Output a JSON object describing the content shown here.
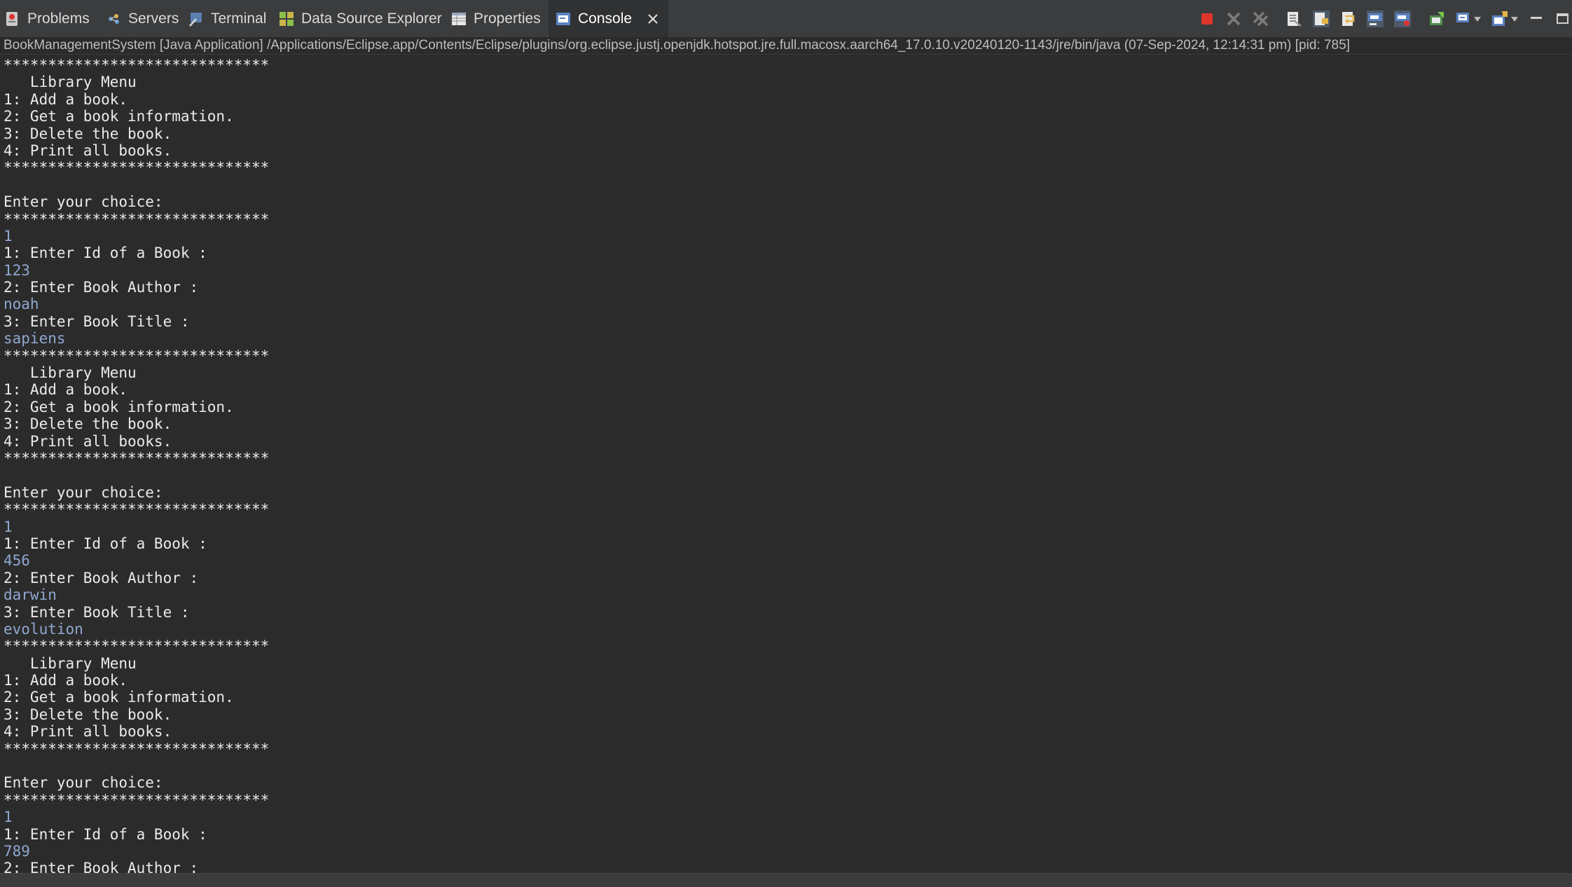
{
  "tabs": [
    {
      "label": "Problems",
      "icon": "problems-icon"
    },
    {
      "label": "Servers",
      "icon": "servers-icon"
    },
    {
      "label": "Terminal",
      "icon": "terminal-icon"
    },
    {
      "label": "Data Source Explorer",
      "icon": "data-source-explorer-icon"
    },
    {
      "label": "Properties",
      "icon": "properties-icon"
    },
    {
      "label": "Console",
      "icon": "console-icon",
      "active": true
    }
  ],
  "toolbar": {
    "buttons": [
      "terminate",
      "remove-launch",
      "remove-all-terminated",
      "clear-console",
      "scroll-lock",
      "word-wrap",
      "show-console-on-stdout",
      "show-console-on-stderr",
      "pin-console",
      "display-selected-console",
      "open-console",
      "minimize",
      "maximize"
    ]
  },
  "launch_info": "BookManagementSystem [Java Application] /Applications/Eclipse.app/Contents/Eclipse/plugins/org.eclipse.justj.openjdk.hotspot.jre.full.macosx.aarch64_17.0.10.v20240120-1143/jre/bin/java  (07-Sep-2024, 12:14:31 pm) [pid: 785]",
  "console": {
    "lines": [
      {
        "text": "******************************",
        "input": false
      },
      {
        "text": "   Library Menu",
        "input": false
      },
      {
        "text": "1: Add a book.",
        "input": false
      },
      {
        "text": "2: Get a book information.",
        "input": false
      },
      {
        "text": "3: Delete the book.",
        "input": false
      },
      {
        "text": "4: Print all books.",
        "input": false
      },
      {
        "text": "******************************",
        "input": false
      },
      {
        "text": "",
        "input": false
      },
      {
        "text": "Enter your choice:",
        "input": false
      },
      {
        "text": "******************************",
        "input": false
      },
      {
        "text": "1",
        "input": true
      },
      {
        "text": "1: Enter Id of a Book :",
        "input": false
      },
      {
        "text": "123",
        "input": true
      },
      {
        "text": "2: Enter Book Author :",
        "input": false
      },
      {
        "text": "noah",
        "input": true
      },
      {
        "text": "3: Enter Book Title :",
        "input": false
      },
      {
        "text": "sapiens",
        "input": true
      },
      {
        "text": "******************************",
        "input": false
      },
      {
        "text": "   Library Menu",
        "input": false
      },
      {
        "text": "1: Add a book.",
        "input": false
      },
      {
        "text": "2: Get a book information.",
        "input": false
      },
      {
        "text": "3: Delete the book.",
        "input": false
      },
      {
        "text": "4: Print all books.",
        "input": false
      },
      {
        "text": "******************************",
        "input": false
      },
      {
        "text": "",
        "input": false
      },
      {
        "text": "Enter your choice:",
        "input": false
      },
      {
        "text": "******************************",
        "input": false
      },
      {
        "text": "1",
        "input": true
      },
      {
        "text": "1: Enter Id of a Book :",
        "input": false
      },
      {
        "text": "456",
        "input": true
      },
      {
        "text": "2: Enter Book Author :",
        "input": false
      },
      {
        "text": "darwin",
        "input": true
      },
      {
        "text": "3: Enter Book Title :",
        "input": false
      },
      {
        "text": "evolution",
        "input": true
      },
      {
        "text": "******************************",
        "input": false
      },
      {
        "text": "   Library Menu",
        "input": false
      },
      {
        "text": "1: Add a book.",
        "input": false
      },
      {
        "text": "2: Get a book information.",
        "input": false
      },
      {
        "text": "3: Delete the book.",
        "input": false
      },
      {
        "text": "4: Print all books.",
        "input": false
      },
      {
        "text": "******************************",
        "input": false
      },
      {
        "text": "",
        "input": false
      },
      {
        "text": "Enter your choice:",
        "input": false
      },
      {
        "text": "******************************",
        "input": false
      },
      {
        "text": "1",
        "input": true
      },
      {
        "text": "1: Enter Id of a Book :",
        "input": false
      },
      {
        "text": "789",
        "input": true
      },
      {
        "text": "2: Enter Book Author :",
        "input": false
      }
    ]
  },
  "colors": {
    "background": "#2b2b2b",
    "tabbar": "#3a3c3e",
    "output_text": "#ebebeb",
    "input_text": "#8fa8cf",
    "terminate_red": "#e0352b"
  }
}
